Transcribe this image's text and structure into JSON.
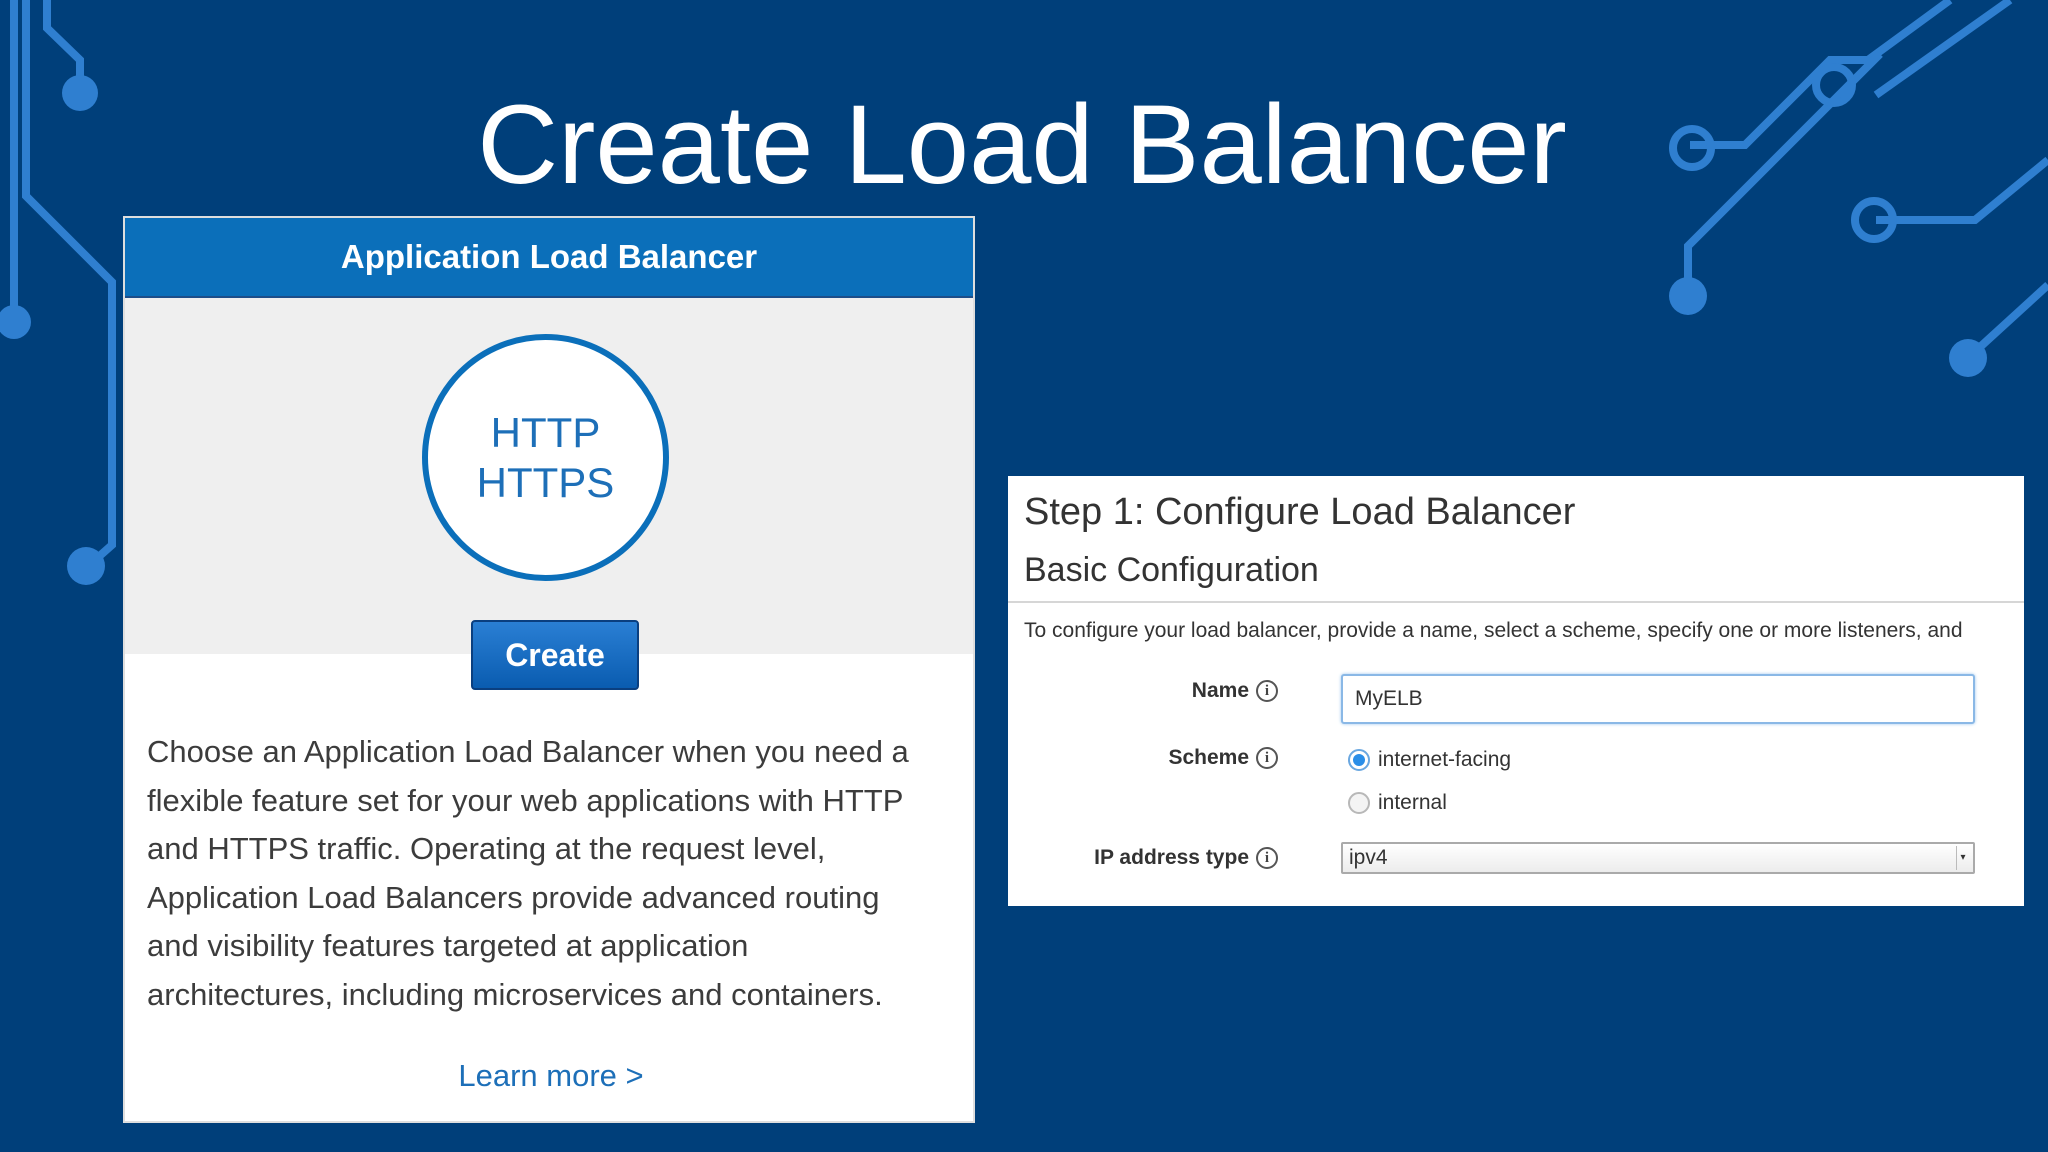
{
  "slide": {
    "title": "Create Load Balancer"
  },
  "alb_card": {
    "header": "Application Load Balancer",
    "protocols": [
      "HTTP",
      "HTTPS"
    ],
    "create_label": "Create",
    "description": "Choose an Application Load Balancer when you need a flexible feature set for your web applications with HTTP and HTTPS traffic. Operating at the request level, Application Load Balancers provide advanced routing and visibility features targeted at application architectures, including microservices and containers.",
    "description_lines": [
      "Choose an Application Load Balancer when you need a",
      "flexible feature set for your web applications with HTTP",
      "and HTTPS traffic. Operating at the request level,",
      "Application Load Balancers provide advanced routing",
      "and visibility features targeted at application",
      "architectures, including microservices and containers."
    ],
    "learn_more": "Learn more >"
  },
  "config": {
    "step_title": "Step 1: Configure Load Balancer",
    "section_title": "Basic Configuration",
    "intro": "To configure your load balancer, provide a name, select a scheme, specify one or more listeners, and",
    "info_symbol": "i",
    "name_label": "Name",
    "name_value": "MyELB",
    "scheme_label": "Scheme",
    "scheme_options": [
      "internet-facing",
      "internal"
    ],
    "scheme_selected": "internet-facing",
    "ip_label": "IP address type",
    "ip_value": "ipv4"
  },
  "colors": {
    "background": "#003f7a",
    "circuit": "#2f7fd0",
    "card_header": "#0b6fba",
    "button": "#0a5cb0",
    "link": "#1d6fb8"
  }
}
